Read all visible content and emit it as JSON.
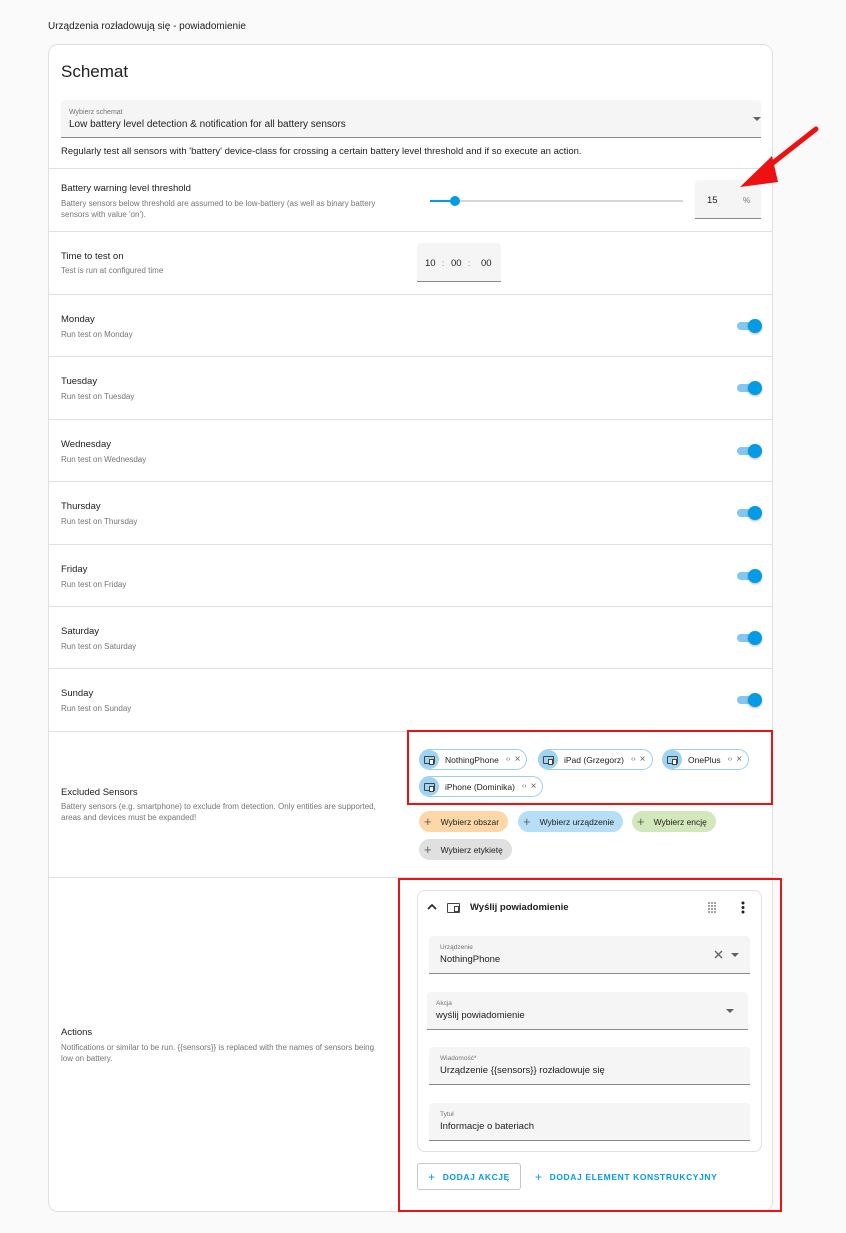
{
  "page": {
    "title": "Urządzenia rozładowują się - powiadomienie"
  },
  "card": {
    "title": "Schemat"
  },
  "blueprint": {
    "label": "Wybierz schemat",
    "value": "Low battery level detection & notification for all battery sensors",
    "description": "Regularly test all sensors with 'battery' device-class for crossing a certain battery level threshold and if so execute an action."
  },
  "threshold": {
    "title": "Battery warning level threshold",
    "desc1": "Battery sensors below threshold are assumed to be low-battery (as well as binary battery",
    "desc2": "sensors with value 'on').",
    "value": "15",
    "unit": "%",
    "slider_fraction": 0.1
  },
  "time": {
    "title": "Time to test on",
    "desc": "Test is run at configured time",
    "hours": "10",
    "minutes": "00",
    "seconds": "00",
    "sep": ":"
  },
  "days": [
    {
      "title": "Monday",
      "desc": "Run test on Monday",
      "on": true
    },
    {
      "title": "Tuesday",
      "desc": "Run test on Tuesday",
      "on": true
    },
    {
      "title": "Wednesday",
      "desc": "Run test on Wednesday",
      "on": true
    },
    {
      "title": "Thursday",
      "desc": "Run test on Thursday",
      "on": true
    },
    {
      "title": "Friday",
      "desc": "Run test on Friday",
      "on": true
    },
    {
      "title": "Saturday",
      "desc": "Run test on Saturday",
      "on": true
    },
    {
      "title": "Sunday",
      "desc": "Run test on Sunday",
      "on": true
    }
  ],
  "excluded": {
    "title": "Excluded Sensors",
    "desc1": "Battery sensors (e.g. smartphone) to exclude from detection. Only entities are supported,",
    "desc2": "areas and devices must be expanded!",
    "chips": [
      "NothingPhone",
      "iPad (Grzegorz)",
      "OnePlus",
      "iPhone (Dominika)"
    ],
    "pickers": {
      "area": "Wybierz obszar",
      "device": "Wybierz urządzenie",
      "entity": "Wybierz encję",
      "label": "Wybierz etykietę"
    },
    "expand_glyph": "‹›",
    "remove_glyph": "×"
  },
  "actions": {
    "title": "Actions",
    "desc1": "Notifications or similar to be run. {{sensors}} is replaced with the names of sensors being",
    "desc2": "low on battery.",
    "card_title": "Wyślij powiadomienie",
    "device_label": "Urządzenie",
    "device_value": "NothingPhone",
    "action_label": "Akcja",
    "action_value": "wyślij powiadomienie",
    "message_label": "Wiadomość*",
    "message_value": "Urządzenie {{sensors}} rozładowuje się",
    "title_label": "Tytuł",
    "title_value": "Informacje o bateriach",
    "add_action": "DODAJ AKCJĘ",
    "add_building_block": "DODAJ ELEMENT KONSTRUKCYJNY"
  },
  "colors": {
    "accent": "#039be5",
    "annotation": "#ee1111"
  }
}
